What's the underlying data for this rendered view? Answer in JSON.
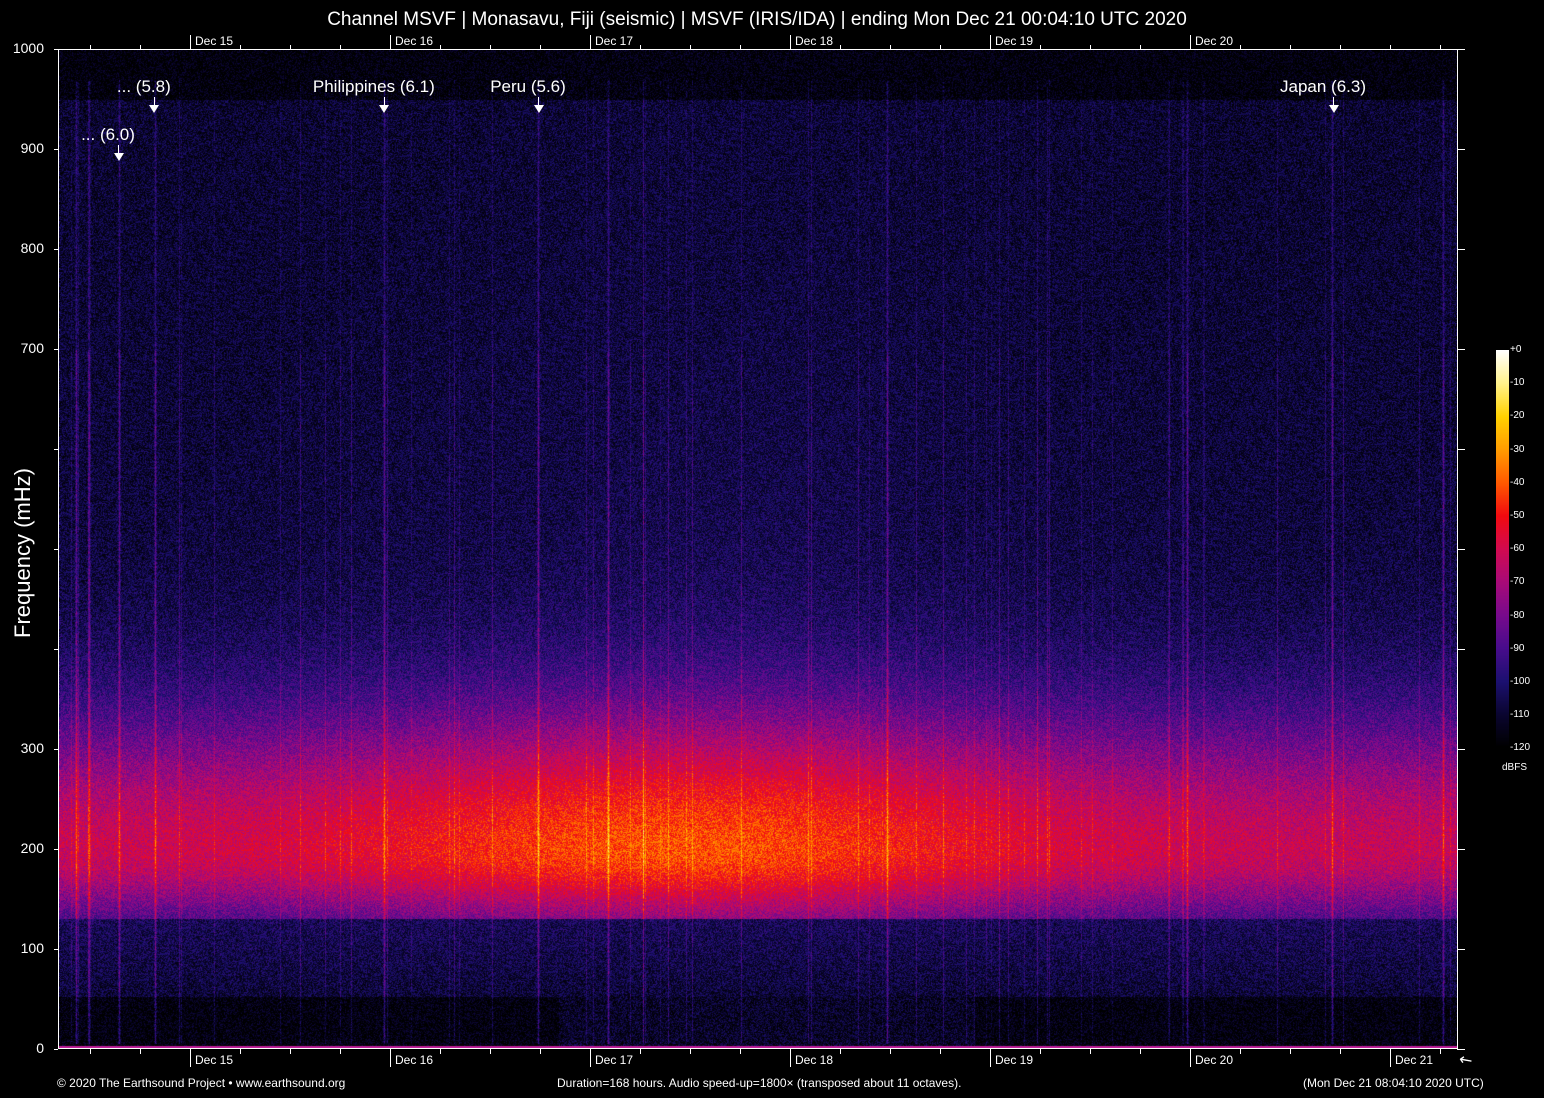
{
  "chart_data": {
    "type": "heatmap",
    "title": "Channel MSVF | Monasavu, Fiji (seismic) | MSVF (IRIS/IDA) | ending Mon Dec 21 00:04:10 UTC 2020",
    "ylabel": "Frequency (mHz)",
    "xlabel": "",
    "ylim": [
      0,
      1000
    ],
    "xlim_hours": [
      0,
      168
    ],
    "y_ticks": [
      0,
      100,
      200,
      300,
      400,
      500,
      600,
      700,
      800,
      900,
      1000
    ],
    "y_tick_labels": {
      "0": "0",
      "100": "100",
      "200": "200",
      "300": "300",
      "700": "700",
      "800": "800",
      "900": "900",
      "1000": "1000"
    },
    "x_date_ticks": [
      {
        "label": "Dec 15",
        "hour": 15.84
      },
      {
        "label": "Dec 16",
        "hour": 39.84
      },
      {
        "label": "Dec 17",
        "hour": 63.84
      },
      {
        "label": "Dec 18",
        "hour": 87.84
      },
      {
        "label": "Dec 19",
        "hour": 111.84
      },
      {
        "label": "Dec 20",
        "hour": 135.84
      },
      {
        "label": "Dec 21",
        "hour": 159.84
      }
    ],
    "top_date_ticks": [
      "Dec 15",
      "Dec 16",
      "Dec 17",
      "Dec 18",
      "Dec 19",
      "Dec 20"
    ],
    "minor_tick_hours": 6,
    "events": [
      {
        "label": "... (6.0)",
        "hour": 7.2,
        "row": 2
      },
      {
        "label": "... (5.8)",
        "hour": 11.5,
        "row": 1
      },
      {
        "label": "Philippines (6.1)",
        "hour": 39.1,
        "row": 1
      },
      {
        "label": "Peru (5.6)",
        "hour": 57.6,
        "row": 1
      },
      {
        "label": "Japan (6.3)",
        "hour": 153.0,
        "row": 1
      }
    ],
    "colorbar": {
      "unit": "dBFS",
      "range": [
        -120,
        0
      ],
      "tick_labels": [
        "+0",
        "-10",
        "-20",
        "-30",
        "-40",
        "-50",
        "-60",
        "-70",
        "-80",
        "-90",
        "-100",
        "-110",
        "-120"
      ],
      "stops": [
        {
          "db": -120,
          "color": "#000000"
        },
        {
          "db": -110,
          "color": "#0a0530"
        },
        {
          "db": -100,
          "color": "#1c1070"
        },
        {
          "db": -90,
          "color": "#480c8c"
        },
        {
          "db": -80,
          "color": "#780a8c"
        },
        {
          "db": -70,
          "color": "#a80a78"
        },
        {
          "db": -60,
          "color": "#d20a50"
        },
        {
          "db": -50,
          "color": "#f20a10"
        },
        {
          "db": -40,
          "color": "#ff5a00"
        },
        {
          "db": -30,
          "color": "#ff9c00"
        },
        {
          "db": -20,
          "color": "#ffd200"
        },
        {
          "db": -10,
          "color": "#fff28a"
        },
        {
          "db": 0,
          "color": "#ffffff"
        }
      ]
    },
    "peak_band_mHz": 200,
    "peak_level_dbfs": -50
  },
  "footer": {
    "copyright": "© 2020 The Earthsound Project • www.earthsound.org",
    "duration": "Duration=168 hours. Audio speed-up=1800× (transposed about 11 octaves).",
    "timestamp": "(Mon Dec 21 08:04:10 2020 UTC)"
  }
}
